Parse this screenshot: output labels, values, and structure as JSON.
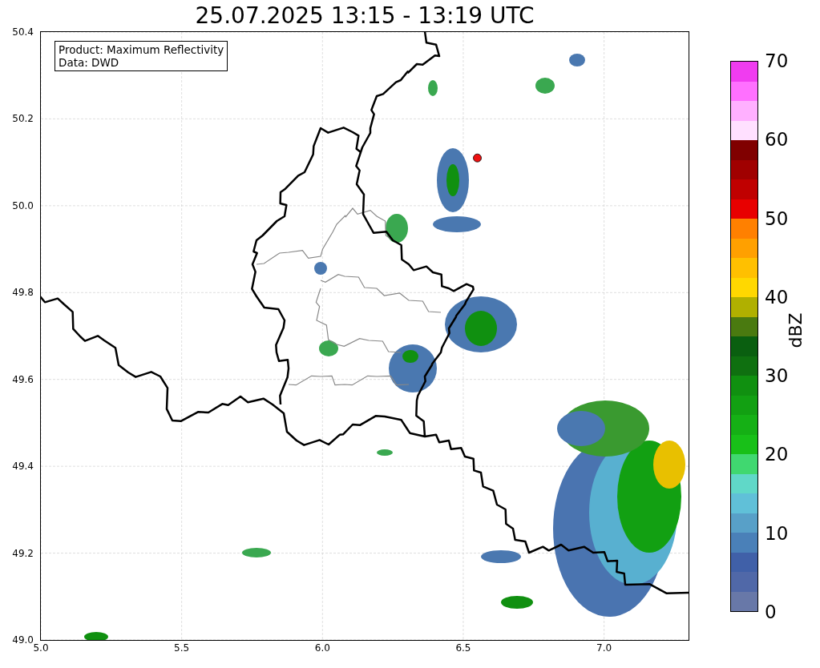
{
  "title": "25.07.2025 13:15 - 13:19 UTC",
  "info_box": {
    "lines": [
      "Product: Maximum Reflectivity",
      "Data: DWD"
    ]
  },
  "x_ticks": [
    "5.0",
    "5.5",
    "6.0",
    "6.5",
    "7.0"
  ],
  "y_ticks": [
    "50.4",
    "50.2",
    "50.0",
    "49.8",
    "49.6",
    "49.4",
    "49.2",
    "49.0"
  ],
  "colorbar": {
    "label": "dBZ",
    "ticks": [
      "70",
      "60",
      "50",
      "40",
      "30",
      "20",
      "10",
      "0"
    ],
    "bands": [
      {
        "color": "#6878a8"
      },
      {
        "color": "#5068a8"
      },
      {
        "color": "#4060a8"
      },
      {
        "color": "#4a80b8"
      },
      {
        "color": "#58a0c8"
      },
      {
        "color": "#60c0d8"
      },
      {
        "color": "#60d8c8"
      },
      {
        "color": "#40d870"
      },
      {
        "color": "#18c018"
      },
      {
        "color": "#15b015"
      },
      {
        "color": "#12a012"
      },
      {
        "color": "#109010"
      },
      {
        "color": "#0f7010"
      },
      {
        "color": "#0a5f10"
      },
      {
        "color": "#4a7a10"
      },
      {
        "color": "#b0b000"
      },
      {
        "color": "#ffd800"
      },
      {
        "color": "#ffc000"
      },
      {
        "color": "#ffa000"
      },
      {
        "color": "#ff8000"
      },
      {
        "color": "#e80000"
      },
      {
        "color": "#c00000"
      },
      {
        "color": "#a00000"
      },
      {
        "color": "#800000"
      },
      {
        "color": "#ffe0ff"
      },
      {
        "color": "#ffb0ff"
      },
      {
        "color": "#ff70ff"
      },
      {
        "color": "#f03cf0"
      }
    ]
  }
}
